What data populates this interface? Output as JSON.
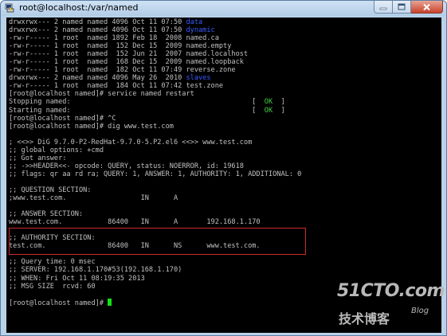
{
  "window": {
    "title": "root@localhost:/var/named"
  },
  "terminal": {
    "lines": [
      [
        {
          "t": "drwxrwx--- 2 named named 4096 Oct 11 07:50 ",
          "c": "n"
        },
        {
          "t": "data",
          "c": "dir"
        }
      ],
      [
        {
          "t": "drwxrwx--- 2 named named 4096 Oct 11 07:50 ",
          "c": "n"
        },
        {
          "t": "dynamic",
          "c": "dir"
        }
      ],
      [
        {
          "t": "-rw-r----- 1 root  named 1892 Feb 18  2008 named.ca",
          "c": "n"
        }
      ],
      [
        {
          "t": "-rw-r----- 1 root  named  152 Dec 15  2009 named.empty",
          "c": "n"
        }
      ],
      [
        {
          "t": "-rw-r----- 1 root  named  152 Jun 21  2007 named.localhost",
          "c": "n"
        }
      ],
      [
        {
          "t": "-rw-r----- 1 root  named  168 Dec 15  2009 named.loopback",
          "c": "n"
        }
      ],
      [
        {
          "t": "-rw-r----- 1 root  named  182 Oct 11 07:49 reverse.zone",
          "c": "n"
        }
      ],
      [
        {
          "t": "drwxrwx--- 2 named named 4096 May 26  2010 ",
          "c": "n"
        },
        {
          "t": "slaves",
          "c": "dir"
        }
      ],
      [
        {
          "t": "-rw-r----- 1 root  named  184 Oct 11 07:42 test.zone",
          "c": "n"
        }
      ],
      [
        {
          "t": "[root@localhost named]# service named restart",
          "c": "n"
        }
      ],
      [
        {
          "t": "Stopping named:                                            [  ",
          "c": "n"
        },
        {
          "t": "OK",
          "c": "ok"
        },
        {
          "t": "  ]",
          "c": "n"
        }
      ],
      [
        {
          "t": "Starting named:                                            [  ",
          "c": "n"
        },
        {
          "t": "OK",
          "c": "ok"
        },
        {
          "t": "  ]",
          "c": "n"
        }
      ],
      [
        {
          "t": "[root@localhost named]# ^C",
          "c": "n"
        }
      ],
      [
        {
          "t": "[root@localhost named]# dig www.test.com",
          "c": "n"
        }
      ],
      [
        {
          "t": "",
          "c": "n"
        }
      ],
      [
        {
          "t": "; <<>> DiG 9.7.0-P2-RedHat-9.7.0-5.P2.el6 <<>> www.test.com",
          "c": "n"
        }
      ],
      [
        {
          "t": ";; global options: +cmd",
          "c": "n"
        }
      ],
      [
        {
          "t": ";; Got answer:",
          "c": "n"
        }
      ],
      [
        {
          "t": ";; ->>HEADER<<- opcode: QUERY, status: NOERROR, id: 19618",
          "c": "n"
        }
      ],
      [
        {
          "t": ";; flags: qr aa rd ra; QUERY: 1, ANSWER: 1, AUTHORITY: 1, ADDITIONAL: 0",
          "c": "n"
        }
      ],
      [
        {
          "t": "",
          "c": "n"
        }
      ],
      [
        {
          "t": ";; QUESTION SECTION:",
          "c": "n"
        }
      ],
      [
        {
          "t": ";www.test.com.                  IN      A",
          "c": "n"
        }
      ],
      [
        {
          "t": "",
          "c": "n"
        }
      ],
      [
        {
          "t": ";; ANSWER SECTION:",
          "c": "n"
        }
      ],
      [
        {
          "t": "www.test.com.           86400   IN      A       192.168.1.170",
          "c": "n"
        }
      ],
      [
        {
          "t": "",
          "c": "n"
        }
      ],
      [
        {
          "t": ";; AUTHORITY SECTION:",
          "c": "n"
        }
      ],
      [
        {
          "t": "test.com.               86400   IN      NS      www.test.com.",
          "c": "n"
        }
      ],
      [
        {
          "t": "",
          "c": "n"
        }
      ],
      [
        {
          "t": ";; Query time: 0 msec",
          "c": "n"
        }
      ],
      [
        {
          "t": ";; SERVER: 192.168.1.170#53(192.168.1.170)",
          "c": "n"
        }
      ],
      [
        {
          "t": ";; WHEN: Fri Oct 11 08:19:35 2013",
          "c": "n"
        }
      ],
      [
        {
          "t": ";; MSG SIZE  rcvd: 60",
          "c": "n"
        }
      ],
      [
        {
          "t": "",
          "c": "n"
        }
      ],
      [
        {
          "t": "[root@localhost named]# ",
          "c": "n"
        },
        {
          "t": "",
          "c": "cursor"
        }
      ]
    ]
  },
  "watermark": {
    "logo": "51CTO.com",
    "subtitle": "技术博客",
    "blog": "Blog"
  },
  "colors": {
    "terminal_bg": "#000000",
    "terminal_fg": "#c0c0c0",
    "directory": "#3a5cff",
    "ok_status": "#40d040",
    "highlight_border": "#cc2b2b",
    "cursor": "#16e016"
  },
  "icons": [
    "putty-icon",
    "minimize-icon",
    "maximize-icon",
    "close-icon"
  ]
}
